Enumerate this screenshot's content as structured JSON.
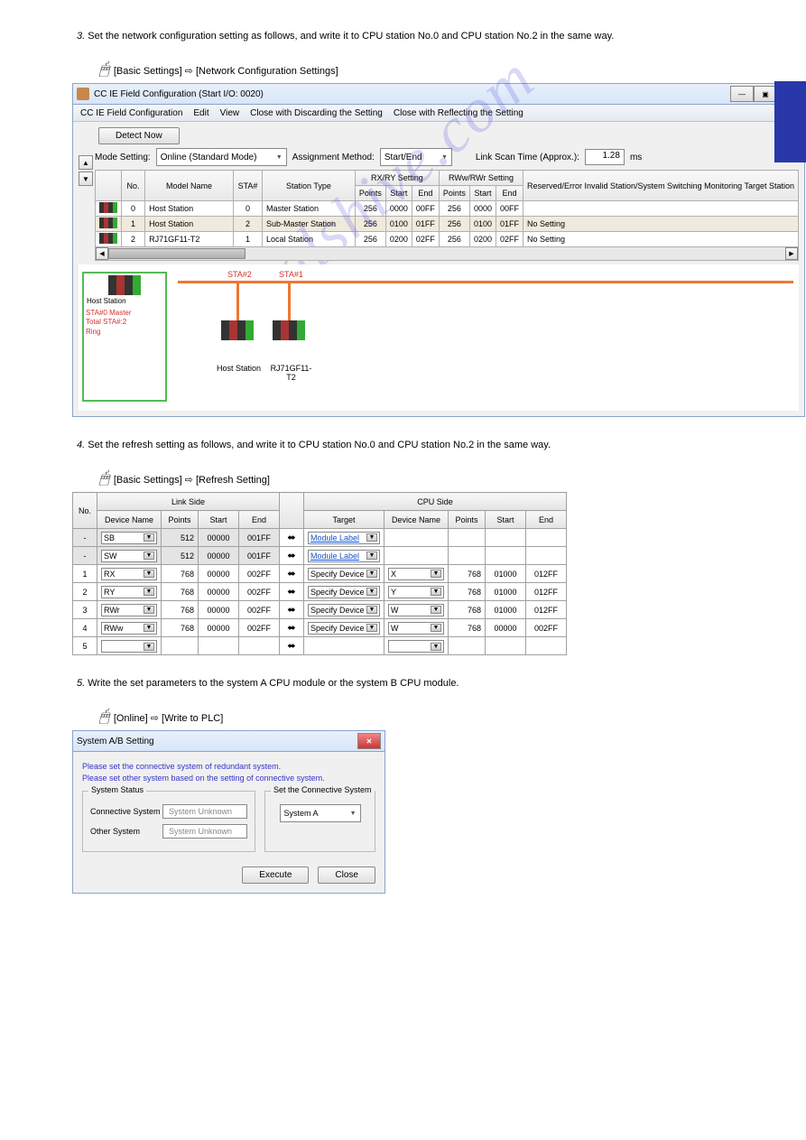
{
  "watermark": "manualshive.com",
  "text1": "Set the network configuration setting as follows, and write it to CPU station No.0 and CPU station No.2 in the same way.",
  "text2": "Set the refresh setting as follows, and write it to CPU station No.0 and CPU station No.2 in the same way.",
  "text3": "Write the set parameters to the system A CPU module or the system B CPU module.",
  "nav1": "[Basic Settings] ⇨ [Network Configuration Settings]",
  "nav2": "[Basic Settings] ⇨ [Refresh Setting]",
  "nav3": "[Online] ⇨ [Write to PLC]",
  "win1": {
    "title": "CC IE Field Configuration (Start I/O: 0020)",
    "menu": [
      "CC IE Field Configuration",
      "Edit",
      "View",
      "Close with Discarding the Setting",
      "Close with Reflecting the Setting"
    ],
    "detect": "Detect Now",
    "mode_label": "Mode Setting:",
    "mode_value": "Online (Standard Mode)",
    "assign_label": "Assignment Method:",
    "assign_value": "Start/End",
    "scan_label": "Link Scan Time (Approx.):",
    "scan_value": "1.28",
    "scan_unit": "ms",
    "headers": {
      "no": "No.",
      "model": "Model Name",
      "sta": "STA#",
      "type": "Station Type",
      "rxry": "RX/RY Setting",
      "rwwr": "RWw/RWr Setting",
      "points": "Points",
      "start": "Start",
      "end": "End",
      "reserved": "Reserved/Error Invalid Station/System Switching Monitoring Target Station"
    },
    "rows": [
      {
        "no": "0",
        "model": "Host Station",
        "sta": "0",
        "type": "Master Station",
        "p1": "256",
        "s1": "0000",
        "e1": "00FF",
        "p2": "256",
        "s2": "0000",
        "e2": "00FF",
        "res": ""
      },
      {
        "no": "1",
        "model": "Host Station",
        "sta": "2",
        "type": "Sub-Master Station",
        "p1": "256",
        "s1": "0100",
        "e1": "01FF",
        "p2": "256",
        "s2": "0100",
        "e2": "01FF",
        "res": "No Setting"
      },
      {
        "no": "2",
        "model": "RJ71GF11-T2",
        "sta": "1",
        "type": "Local Station",
        "p1": "256",
        "s1": "0200",
        "e1": "02FF",
        "p2": "256",
        "s2": "0200",
        "e2": "02FF",
        "res": "No Setting"
      }
    ],
    "topo": {
      "host": "Host Station",
      "host_red": "STA#0 Master\nTotal STA#:2\nRing",
      "sta2": "STA#2",
      "sta1": "STA#1",
      "lbl_host": "Host Station",
      "lbl_rj": "RJ71GF11-T2"
    }
  },
  "win2": {
    "h": {
      "no": "No.",
      "link": "Link Side",
      "cpu": "CPU Side",
      "dev": "Device Name",
      "pts": "Points",
      "start": "Start",
      "end": "End",
      "target": "Target"
    },
    "rows": [
      {
        "no": "-",
        "dn": "SB",
        "pts": "512",
        "st": "00000",
        "en": "001FF",
        "tgt": "Module Label",
        "cdn": "",
        "cpts": "",
        "cst": "",
        "cen": ""
      },
      {
        "no": "-",
        "dn": "SW",
        "pts": "512",
        "st": "00000",
        "en": "001FF",
        "tgt": "Module Label",
        "cdn": "",
        "cpts": "",
        "cst": "",
        "cen": ""
      },
      {
        "no": "1",
        "dn": "RX",
        "pts": "768",
        "st": "00000",
        "en": "002FF",
        "tgt": "Specify Device",
        "cdn": "X",
        "cpts": "768",
        "cst": "01000",
        "cen": "012FF"
      },
      {
        "no": "2",
        "dn": "RY",
        "pts": "768",
        "st": "00000",
        "en": "002FF",
        "tgt": "Specify Device",
        "cdn": "Y",
        "cpts": "768",
        "cst": "01000",
        "cen": "012FF"
      },
      {
        "no": "3",
        "dn": "RWr",
        "pts": "768",
        "st": "00000",
        "en": "002FF",
        "tgt": "Specify Device",
        "cdn": "W",
        "cpts": "768",
        "cst": "01000",
        "cen": "012FF"
      },
      {
        "no": "4",
        "dn": "RWw",
        "pts": "768",
        "st": "00000",
        "en": "002FF",
        "tgt": "Specify Device",
        "cdn": "W",
        "cpts": "768",
        "cst": "00000",
        "cen": "002FF"
      },
      {
        "no": "5",
        "dn": "",
        "pts": "",
        "st": "",
        "en": "",
        "tgt": "",
        "cdn": "",
        "cpts": "",
        "cst": "",
        "cen": ""
      }
    ]
  },
  "win3": {
    "title": "System A/B Setting",
    "msg": "Please set the connective system of redundant system.\nPlease set other system based on the setting of connective system.",
    "status_legend": "System Status",
    "set_legend": "Set the Connective System",
    "conn": "Connective System",
    "other": "Other System",
    "unknown": "System Unknown",
    "sysa": "System A",
    "execute": "Execute",
    "close": "Close"
  },
  "chart_data": null
}
